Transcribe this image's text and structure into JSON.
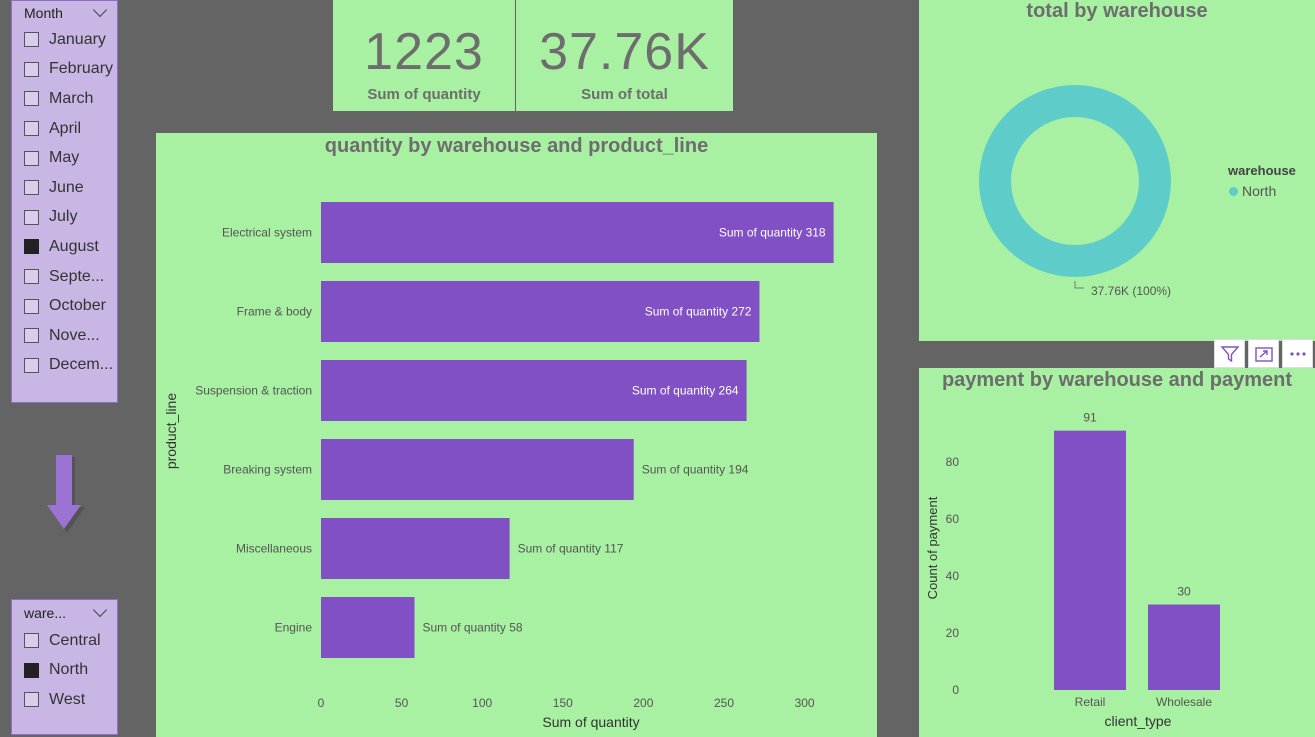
{
  "month_slicer": {
    "title": "Month",
    "items": [
      {
        "label": "January",
        "checked": false
      },
      {
        "label": "February",
        "checked": false
      },
      {
        "label": "March",
        "checked": false
      },
      {
        "label": "April",
        "checked": false
      },
      {
        "label": "May",
        "checked": false
      },
      {
        "label": "June",
        "checked": false
      },
      {
        "label": "July",
        "checked": false
      },
      {
        "label": "August",
        "checked": true
      },
      {
        "label": "Septe...",
        "checked": false
      },
      {
        "label": "October",
        "checked": false
      },
      {
        "label": "Nove...",
        "checked": false
      },
      {
        "label": "Decem...",
        "checked": false
      }
    ]
  },
  "warehouse_slicer": {
    "title": "ware...",
    "items": [
      {
        "label": "Central",
        "checked": false
      },
      {
        "label": "North",
        "checked": true
      },
      {
        "label": "West",
        "checked": false
      }
    ]
  },
  "cards": {
    "quantity": {
      "value": "1223",
      "label": "Sum of quantity"
    },
    "total": {
      "value": "37.76K",
      "label": "Sum of total"
    }
  },
  "colors": {
    "background": "#646464",
    "panel": "#a8f0a2",
    "bar": "#8050c4",
    "donut": "#5ecdc9",
    "slicer": "#c8b6e4"
  },
  "toolbar": {
    "icons": [
      "filter-icon",
      "focus-mode-icon",
      "more-options-icon"
    ]
  },
  "chart_data": [
    {
      "type": "bar",
      "orientation": "horizontal",
      "title": "quantity by warehouse and product_line",
      "xlabel": "Sum of quantity",
      "ylabel": "product_line",
      "categories": [
        "Electrical system",
        "Frame & body",
        "Suspension & traction",
        "Breaking system",
        "Miscellaneous",
        "Engine"
      ],
      "values": [
        318,
        272,
        264,
        194,
        117,
        58
      ],
      "data_labels": [
        "Sum of quantity 318",
        "Sum of quantity 272",
        "Sum of quantity 264",
        "Sum of quantity 194",
        "Sum of quantity 117",
        "Sum of quantity 58"
      ],
      "xticks": [
        "0",
        "50",
        "100",
        "150",
        "200",
        "250",
        "300"
      ],
      "xlim": [
        0,
        300
      ],
      "grid": false
    },
    {
      "type": "pie",
      "subtype": "donut",
      "title": "total by warehouse",
      "legend_title": "warehouse",
      "legend_position": "right",
      "categories": [
        "North"
      ],
      "values": [
        37760
      ],
      "data_labels": [
        "37.76K (100%)"
      ]
    },
    {
      "type": "bar",
      "orientation": "vertical",
      "title": "payment by warehouse and payment",
      "xlabel": "client_type",
      "ylabel": "Count of payment",
      "categories": [
        "Retail",
        "Wholesale"
      ],
      "values": [
        91,
        30
      ],
      "data_labels": [
        "91",
        "30"
      ],
      "yticks": [
        "0",
        "20",
        "40",
        "60",
        "80"
      ],
      "ylim": [
        0,
        80
      ],
      "grid": false
    }
  ]
}
